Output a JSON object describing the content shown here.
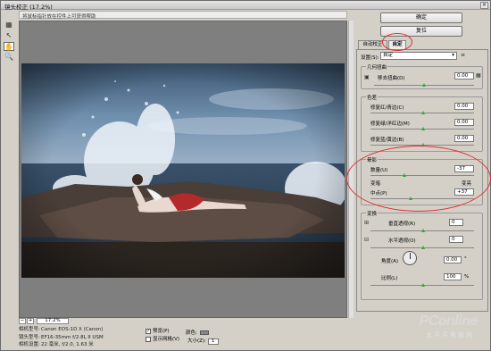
{
  "window": {
    "title": "镜头校正 (17.2%)",
    "close": "×"
  },
  "hint": "将鼠标指针放在控件上可获得帮助",
  "tools": [
    {
      "name": "remove-distortion-tool",
      "glyph": "▦"
    },
    {
      "name": "straighten-tool",
      "glyph": "↖"
    },
    {
      "name": "hand-tool",
      "glyph": "✋"
    },
    {
      "name": "zoom-tool",
      "glyph": "🔍"
    }
  ],
  "zoom": {
    "minus": "−",
    "plus": "+",
    "value": "17.2%"
  },
  "camera_info": {
    "labels": [
      "相机型号:",
      "镜头型号:",
      "相机设置:"
    ],
    "values": [
      "Canon EOS-1D X (Canon)",
      "EF16-35mm f/2.8L II USM",
      "22 毫米, f/2.0, 1.63 米"
    ]
  },
  "options": {
    "preview": "预览(P)",
    "show_grid": "显示网格(V)",
    "color_label": "颜色:",
    "size_label": "大小(Z):",
    "size_value": "1"
  },
  "buttons": {
    "ok": "确定",
    "reset": "复位"
  },
  "tabs": {
    "auto": "自动校正",
    "custom": "自定"
  },
  "settings": {
    "label": "设置(S):",
    "value": "自定"
  },
  "geometric": {
    "title": "几何扭曲",
    "remove_label": "移去扭曲(D)",
    "remove_value": "0.00"
  },
  "chromatic": {
    "title": "色差",
    "rows": [
      {
        "label": "修复红/青边(C)",
        "value": "0.00"
      },
      {
        "label": "修复绿/洋红边(M)",
        "value": "0.00"
      },
      {
        "label": "修复蓝/黄边(B)",
        "value": "0.00"
      }
    ]
  },
  "vignette": {
    "title": "晕影",
    "amount_label": "数量(U)",
    "amount_value": "-37",
    "dark": "变暗",
    "light": "变亮",
    "midpoint_label": "中点(P)",
    "midpoint_value": "+37"
  },
  "transform": {
    "title": "变换",
    "vertical_label": "垂直透视(R)",
    "vertical_value": "0",
    "horizontal_label": "水平透视(O)",
    "horizontal_value": "0",
    "angle_label": "角度(A)",
    "angle_value": "0.00",
    "angle_unit": "°",
    "scale_label": "比例(L)",
    "scale_value": "100",
    "scale_unit": "%"
  },
  "watermark": {
    "brand": "PConline",
    "sub": "太平洋电脑网"
  },
  "colors": {
    "accent_circle": "#e03030",
    "slider_thumb": "#33aa33"
  }
}
